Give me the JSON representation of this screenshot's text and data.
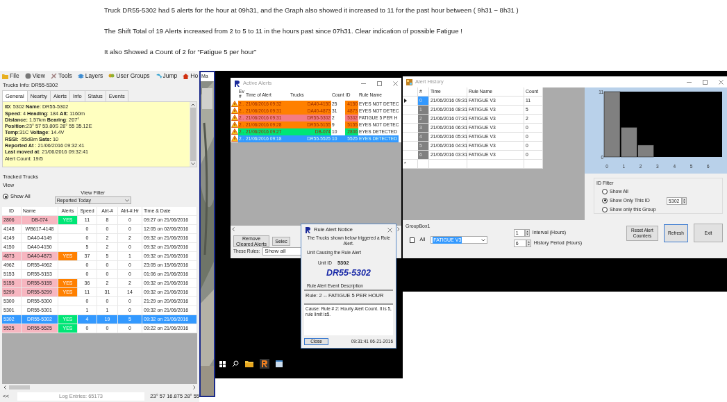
{
  "notes": [
    "Truck DR55-5302 had 5 alerts for the hour at 09h31, and the Graph also showed it increased to 11 for the past hour between ( 9h31 **–** 8h31 )",
    "The Shift Total of 19 Alerts increased from 2 to 5 to 11 in the hours past since 07h31.   Clear indication of possible Fatigue !",
    "It also Showed a Count of 2 for “Fatigue 5 per hour”"
  ],
  "tracker": {
    "menu": [
      "File",
      "View",
      "Tools",
      "Layers",
      "User Groups",
      "Jump",
      "Ho"
    ],
    "truck_info_title": "Trucks Info: DR55-5302",
    "tabs": [
      {
        "label": "General",
        "selected": true
      },
      {
        "label": "Nearby",
        "selected": false
      },
      {
        "label": "Alerts",
        "selected": false
      },
      {
        "label": "Info",
        "selected": false
      },
      {
        "label": "Status",
        "selected": false
      },
      {
        "label": "Events",
        "selected": false
      }
    ],
    "info_lines": [
      "**ID:**  5302  **Name**: DR55-5302",
      "**Speed**: 4  **Heading**: 184 **Alt:** 1160m",
      "**Distance:** 1.57km   **Bearing**: 207°",
      "**Position**:23° 57 53.80S  28° 55 35.12E",
      "**Temp**:31C  **Voltage**: 14.4V",
      "**RSSI:** -55dBm **Sats:** 10",
      "**Reported At**  : 21/06/2016 09:32:41",
      "**Last moved at**: 21/06/2016 09:32:41",
      "Alert Count: 19/5"
    ],
    "tracked_title": "Tracked Trucks",
    "view_label": "View",
    "view_radio": {
      "label": "Show All",
      "selected": true
    },
    "filter_label": "View Filter",
    "filter_value": "Reported Today",
    "columns": [
      "ID",
      "Name",
      "Alerts",
      "Speed",
      "Alrt-#",
      "Alrt-#:Hr",
      "Time & Date"
    ],
    "rows": [
      {
        "cells": [
          "2806",
          "DB-074",
          "YES",
          "11",
          "8",
          "0",
          "09:27 on 21/06/2016"
        ],
        "flagged": true,
        "color": "#00e676",
        "selected": false
      },
      {
        "cells": [
          "4148",
          "WB617-4148",
          "",
          "0",
          "0",
          "0",
          "12:05 on 02/06/2016"
        ],
        "flagged": false,
        "selected": false
      },
      {
        "cells": [
          "4149",
          "DA40-4149",
          "",
          "0",
          "2",
          "2",
          "09:32 on 21/06/2016"
        ],
        "flagged": false,
        "selected": false
      },
      {
        "cells": [
          "4150",
          "DA40-4150",
          "",
          "5",
          "2",
          "0",
          "09:32 on 21/06/2016"
        ],
        "flagged": false,
        "selected": false
      },
      {
        "cells": [
          "4873",
          "DA40-4873",
          "YES",
          "37",
          "5",
          "1",
          "09:32 on 21/06/2016"
        ],
        "flagged": true,
        "color": "#ff8000",
        "selected": false
      },
      {
        "cells": [
          "4962",
          "DR55-4962",
          "",
          "0",
          "0",
          "0",
          "23:05 on 15/06/2016"
        ],
        "flagged": false,
        "selected": false
      },
      {
        "cells": [
          "5153",
          "DR55-5153",
          "",
          "0",
          "0",
          "0",
          "01:06 on 21/06/2016"
        ],
        "flagged": false,
        "selected": false
      },
      {
        "cells": [
          "5155",
          "DR55-5155",
          "YES",
          "36",
          "2",
          "2",
          "09:32 on 21/06/2016"
        ],
        "flagged": true,
        "color": "#ff8000",
        "selected": false
      },
      {
        "cells": [
          "5299",
          "DR55-5299",
          "YES",
          "11",
          "31",
          "14",
          "09:32 on 21/06/2016"
        ],
        "flagged": true,
        "color": "#ff8000",
        "selected": false
      },
      {
        "cells": [
          "5300",
          "DR55-5300",
          "",
          "0",
          "0",
          "0",
          "21:29 on 20/06/2016"
        ],
        "flagged": false,
        "selected": false
      },
      {
        "cells": [
          "5301",
          "DR55-5301",
          "",
          "1",
          "1",
          "0",
          "09:32 on 21/06/2016"
        ],
        "flagged": false,
        "selected": false
      },
      {
        "cells": [
          "5302",
          "DR55-5302",
          "YES",
          "4",
          "19",
          "5",
          "09:32 on 21/06/2016"
        ],
        "flagged": true,
        "color": "#00e676",
        "selected": true
      },
      {
        "cells": [
          "5525",
          "DR55-5525",
          "YES",
          "0",
          "0",
          "0",
          "09:22 on 21/06/2016"
        ],
        "flagged": true,
        "color": "#00e676",
        "selected": false
      }
    ],
    "status_back": "<<",
    "log_entries": "Log Entries: 65173",
    "coords": "23° 57 16.875 28° 55",
    "map_tab": "Ma"
  },
  "active_alerts": {
    "title": "Active Alerts",
    "columns": [
      "Ev #",
      "Time of Alert",
      "Trucks",
      "Count",
      "ID",
      "Rule Name"
    ],
    "rows": [
      {
        "ev": "2..",
        "time": "21/06/2016 09:32",
        "truck": "DA40-4150",
        "count": "25",
        "id": "4150",
        "rule": "EYES NOT DETEC",
        "color": "#ff8000",
        "selected": false
      },
      {
        "ev": "2..",
        "time": "21/06/2016 09:31",
        "truck": "DA40-4873",
        "count": "31",
        "id": "4873",
        "rule": "EYES NOT DETEC",
        "color": "#ff8000",
        "selected": false
      },
      {
        "ev": "2..",
        "time": "21/06/2016 09:31",
        "truck": "DR55-5302",
        "count": "2",
        "id": "5302",
        "rule": "FATIGUE 5 PER H",
        "color": "#f47c84",
        "selected": false
      },
      {
        "ev": "2..",
        "time": "21/06/2016 09:28",
        "truck": "DR55-5155",
        "count": "9",
        "id": "5155",
        "rule": "EYES NOT DETEC",
        "color": "#ff8000",
        "selected": false
      },
      {
        "ev": "2..",
        "time": "21/06/2016 09:27",
        "truck": "DB-074",
        "count": "10",
        "id": "2806",
        "rule": "EYES DETECTED",
        "color": "#00e676",
        "selected": false
      },
      {
        "ev": "2..",
        "time": "21/06/2016 09:18",
        "truck": "DR55-5525",
        "count": "10",
        "id": "5525",
        "rule": "EYES DETECTED",
        "selected": true
      }
    ],
    "remove_button": "Remove Cleared Alerts",
    "select_button": "Selec",
    "rules_label": "These Rules:",
    "rules_value": "Show all"
  },
  "rule_notice": {
    "title": "Rule Alert Notice",
    "intro": "The Trucks shown below triggered a Rule Alert.",
    "unit_group": "Unit Causing the Rule Alert",
    "unit_id_label": "Unit ID",
    "unit_id": "5302",
    "unit_name": "DR55-5302",
    "desc_label": "Rule Alert Event Description",
    "rule": "Rule:  2 -- FATIGUE 5 PER HOUR",
    "cause": "Cause: Rule # 2:  Hourly Alert Count. It is 5, rule limit is5.",
    "close": "Close",
    "timestamp": "09:31:41 06-21-2016"
  },
  "alert_history": {
    "title": "Alert History",
    "columns": [
      "#",
      "Time",
      "Rule Name",
      "Count"
    ],
    "rows": [
      {
        "n": "0",
        "time": "21/06/2016 09:31",
        "rule": "FATIGUE V3",
        "count": "11",
        "selected": true
      },
      {
        "n": "1",
        "time": "21/06/2016 08:31",
        "rule": "FATIGUE V3",
        "count": "5",
        "selected": false
      },
      {
        "n": "2",
        "time": "21/06/2016 07:31",
        "rule": "FATIGUE V3",
        "count": "2",
        "selected": false
      },
      {
        "n": "3",
        "time": "21/06/2016 06:31",
        "rule": "FATIGUE V3",
        "count": "0",
        "selected": false
      },
      {
        "n": "4",
        "time": "21/06/2016 05:31",
        "rule": "FATIGUE V3",
        "count": "0",
        "selected": false
      },
      {
        "n": "5",
        "time": "21/06/2016 04:31",
        "rule": "FATIGUE V3",
        "count": "0",
        "selected": false
      },
      {
        "n": "6",
        "time": "21/06/2016 03:31",
        "rule": "FATIGUE V3",
        "count": "0",
        "selected": false
      }
    ],
    "new_row_mark": "*",
    "chart_data": {
      "type": "bar",
      "categories": [
        "0",
        "1",
        "2",
        "3",
        "4",
        "5",
        "6"
      ],
      "series": [
        {
          "color": "#808080",
          "values": [
            11,
            5,
            2,
            0,
            0,
            0,
            0
          ]
        }
      ],
      "ylim": [
        0,
        11
      ],
      "yticks": [
        0,
        11
      ]
    },
    "groupbox": "GroupBox1",
    "all_checkbox": {
      "label": "All",
      "checked": false
    },
    "rule_combo": "FATIGUE V3",
    "interval_value": "1",
    "interval_label": "Interval (Hours)",
    "period_value": "6",
    "period_label": "History Period (Hours)",
    "filter_title": "ID Filter",
    "filter_options": [
      {
        "label": "Show All",
        "selected": false
      },
      {
        "label": "Show Only This ID",
        "selected": true
      },
      {
        "label": "Show only this Group",
        "selected": false
      }
    ],
    "filter_id": "5302",
    "buttons": [
      {
        "label": "Reset Alert Counters",
        "focused": false
      },
      {
        "label": "Refresh",
        "focused": true
      },
      {
        "label": "Exit",
        "focused": false
      }
    ]
  }
}
